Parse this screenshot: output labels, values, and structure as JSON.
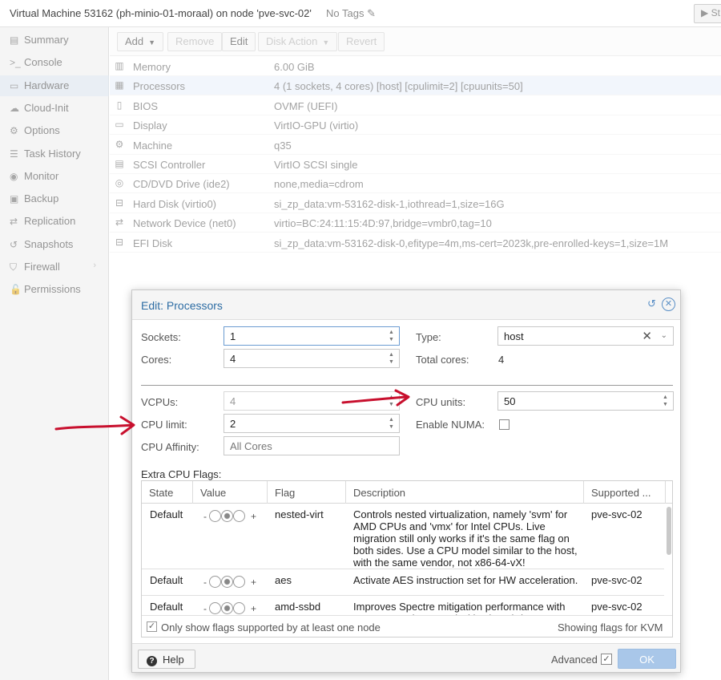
{
  "header": {
    "title": "Virtual Machine 53162 (ph-minio-01-moraal) on node 'pve-svc-02'",
    "no_tags": "No Tags",
    "start_label": "St"
  },
  "sidebar": {
    "items": [
      {
        "label": "Summary",
        "icon": "book-icon",
        "glyph": "▤"
      },
      {
        "label": "Console",
        "icon": "terminal-icon",
        "glyph": ">_"
      },
      {
        "label": "Hardware",
        "icon": "monitor-icon",
        "glyph": "▭"
      },
      {
        "label": "Cloud-Init",
        "icon": "cloud-icon",
        "glyph": "☁"
      },
      {
        "label": "Options",
        "icon": "gear-icon",
        "glyph": "⚙"
      },
      {
        "label": "Task History",
        "icon": "list-icon",
        "glyph": "☰"
      },
      {
        "label": "Monitor",
        "icon": "eye-icon",
        "glyph": "◉"
      },
      {
        "label": "Backup",
        "icon": "floppy-icon",
        "glyph": "▣"
      },
      {
        "label": "Replication",
        "icon": "retweet-icon",
        "glyph": "⇄"
      },
      {
        "label": "Snapshots",
        "icon": "history-icon",
        "glyph": "↺"
      },
      {
        "label": "Firewall",
        "icon": "shield-icon",
        "glyph": "⛉"
      },
      {
        "label": "Permissions",
        "icon": "unlock-icon",
        "glyph": "🔓"
      }
    ],
    "active_index": 2
  },
  "toolbar": {
    "add": "Add",
    "remove": "Remove",
    "edit": "Edit",
    "disk_action": "Disk Action",
    "revert": "Revert"
  },
  "hardware": [
    {
      "icon": "memory-icon",
      "glyph": "▥",
      "key": "Memory",
      "value": "6.00 GiB"
    },
    {
      "icon": "cpu-icon",
      "glyph": "▦",
      "key": "Processors",
      "value": "4 (1 sockets, 4 cores) [host] [cpulimit=2] [cpuunits=50]"
    },
    {
      "icon": "chip-icon",
      "glyph": "▯",
      "key": "BIOS",
      "value": "OVMF (UEFI)"
    },
    {
      "icon": "desktop-icon",
      "glyph": "▭",
      "key": "Display",
      "value": "VirtIO-GPU (virtio)"
    },
    {
      "icon": "cogs-icon",
      "glyph": "⚙",
      "key": "Machine",
      "value": "q35"
    },
    {
      "icon": "database-icon",
      "glyph": "▤",
      "key": "SCSI Controller",
      "value": "VirtIO SCSI single"
    },
    {
      "icon": "cdrom-icon",
      "glyph": "◎",
      "key": "CD/DVD Drive (ide2)",
      "value": "none,media=cdrom"
    },
    {
      "icon": "hdd-icon",
      "glyph": "⊟",
      "key": "Hard Disk (virtio0)",
      "value": "si_zp_data:vm-53162-disk-1,iothread=1,size=16G"
    },
    {
      "icon": "exchange-icon",
      "glyph": "⇄",
      "key": "Network Device (net0)",
      "value": "virtio=BC:24:11:15:4D:97,bridge=vmbr0,tag=10"
    },
    {
      "icon": "hdd-icon",
      "glyph": "⊟",
      "key": "EFI Disk",
      "value": "si_zp_data:vm-53162-disk-0,efitype=4m,ms-cert=2023k,pre-enrolled-keys=1,size=1M"
    }
  ],
  "hardware_selected_index": 1,
  "dialog": {
    "title": "Edit: Processors",
    "sockets_label": "Sockets:",
    "sockets_value": "1",
    "cores_label": "Cores:",
    "cores_value": "4",
    "type_label": "Type:",
    "type_value": "host",
    "total_cores_label": "Total cores:",
    "total_cores_value": "4",
    "vcpus_label": "VCPUs:",
    "vcpus_value": "4",
    "cpu_limit_label": "CPU limit:",
    "cpu_limit_value": "2",
    "cpu_affinity_label": "CPU Affinity:",
    "cpu_affinity_placeholder": "All Cores",
    "cpu_units_label": "CPU units:",
    "cpu_units_value": "50",
    "enable_numa_label": "Enable NUMA:",
    "enable_numa_checked": false,
    "extra_flags_label": "Extra CPU Flags:",
    "grid_headers": {
      "state": "State",
      "value": "Value",
      "flag": "Flag",
      "description": "Description",
      "supported": "Supported ..."
    },
    "flags": [
      {
        "state": "Default",
        "flag": "nested-virt",
        "description": "Controls nested virtualization, namely 'svm' for AMD CPUs and 'vmx' for Intel CPUs. Live migration still only works if it's the same flag on both sides. Use a CPU model similar to the host, with the same vendor, not x86-64-vX!",
        "supported": "pve-svc-02"
      },
      {
        "state": "Default",
        "flag": "aes",
        "description": "Activate AES instruction set for HW acceleration.",
        "supported": "pve-svc-02"
      },
      {
        "state": "Default",
        "flag": "amd-ssbd",
        "description": "Improves Spectre mitigation performance with AMD CPUs, best used with 'virt-ssbd'.",
        "supported": "pve-svc-02"
      }
    ],
    "tristate_minus": "-",
    "tristate_plus": "+",
    "only_supported_label": "Only show flags supported by at least one node",
    "only_supported_checked": true,
    "showing_flags_label": "Showing flags for KVM",
    "help_label": "Help",
    "advanced_label": "Advanced",
    "advanced_checked": true,
    "ok_label": "OK"
  },
  "colors": {
    "accent": "#2e6da4",
    "annotation_red": "#c8102e",
    "selected_row": "#e7effa",
    "ok_button": "#a9c7e9"
  }
}
